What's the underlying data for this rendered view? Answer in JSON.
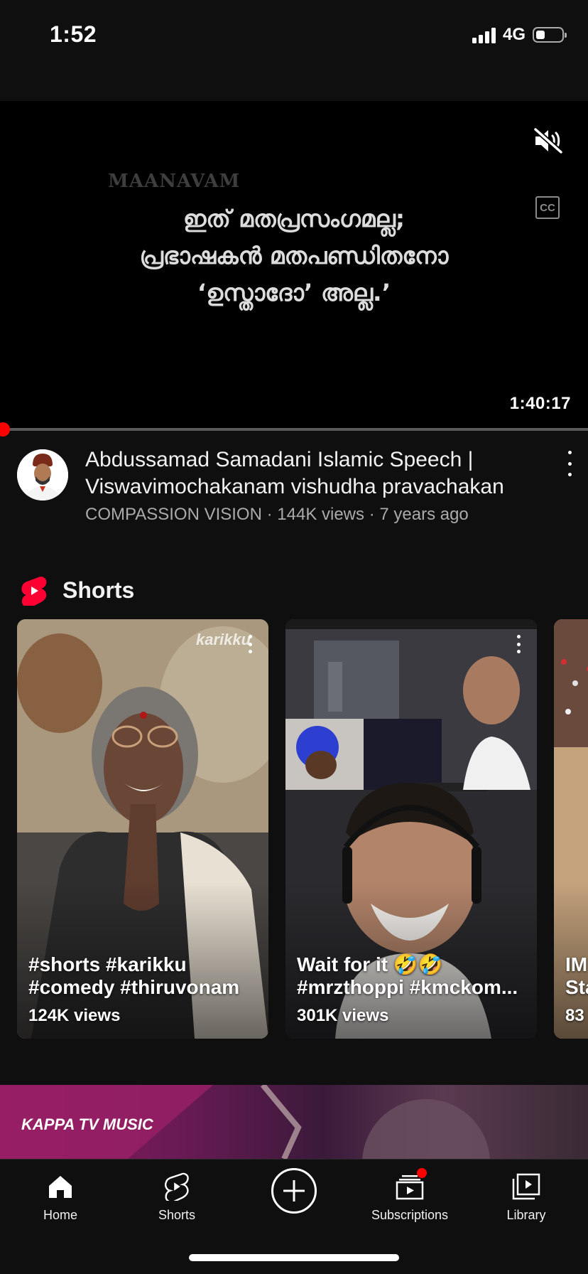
{
  "status_bar": {
    "time": "1:52",
    "network": "4G"
  },
  "player": {
    "watermark": "MAANAVAM",
    "subtitle_lines": [
      "ഇത് മതപ്രസംഗമല്ല;",
      "പ്രഭാഷകൻ മതപണ്ഡിതനോ",
      "‘ഉസ്താദോ’ അല്ല.’"
    ],
    "cc_label": "CC",
    "duration": "1:40:17",
    "progress_fraction": 0.005
  },
  "video": {
    "title": "Abdussamad Samadani Islamic Speech | Viswavimochakanam vishudha pravachakan",
    "channel": "COMPASSION VISION",
    "views": "144K views",
    "age": "7 years ago",
    "separator": "·"
  },
  "shorts": {
    "heading": "Shorts",
    "items": [
      {
        "title_lines": [
          "#shorts #karikku",
          "#comedy #thiruvonam"
        ],
        "views": "124K views",
        "overlay_text": "karikku"
      },
      {
        "title_lines": [
          "Wait for it 🤣🤣",
          "#mrzthoppi #kmckom..."
        ],
        "views": "301K views"
      },
      {
        "title_lines": [
          "IM",
          "Sta"
        ],
        "views": "83"
      }
    ]
  },
  "next_video": {
    "brand_text": "KAPPA TV MUSIC"
  },
  "bottom_nav": {
    "items": [
      {
        "label": "Home",
        "icon": "home-icon"
      },
      {
        "label": "Shorts",
        "icon": "shorts-icon"
      },
      {
        "label": "",
        "icon": "create-icon"
      },
      {
        "label": "Subscriptions",
        "icon": "subscriptions-icon"
      },
      {
        "label": "Library",
        "icon": "library-icon"
      }
    ]
  },
  "colors": {
    "background": "#0f0f0f",
    "accent_red": "#ff0000",
    "secondary_text": "#aaaaaa"
  }
}
